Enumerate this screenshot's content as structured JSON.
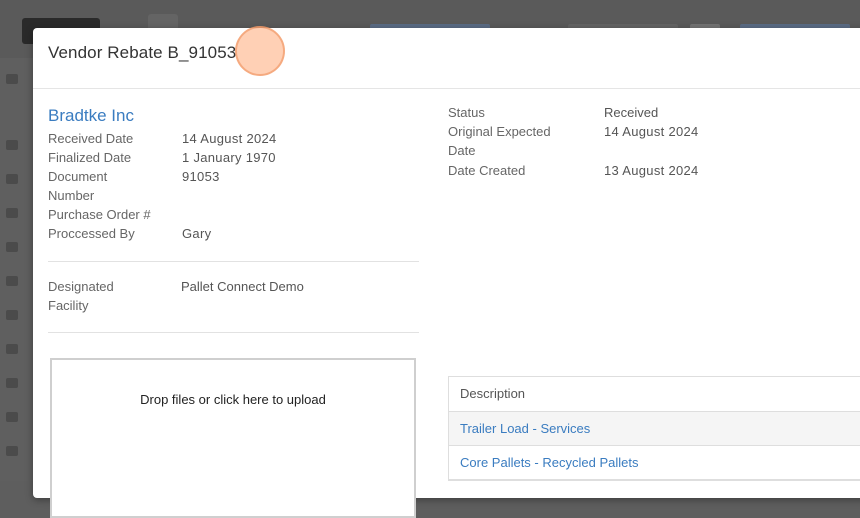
{
  "modal": {
    "title": "Vendor Rebate B_91053"
  },
  "vendor": {
    "name": "Bradtke Inc"
  },
  "details_left": [
    {
      "label": "Received Date",
      "value": "14 August 2024"
    },
    {
      "label": "Finalized Date",
      "value": "1 January 1970"
    },
    {
      "label": "Document Number",
      "value": "91053"
    },
    {
      "label": "Purchase Order #",
      "value": ""
    },
    {
      "label": "Proccessed By",
      "value": "Gary"
    }
  ],
  "facility": {
    "label": "Designated Facility",
    "value": "Pallet Connect Demo"
  },
  "details_right": [
    {
      "label": "Status",
      "value": "Received"
    },
    {
      "label": "Original Expected Date",
      "value": "14 August 2024"
    },
    {
      "label": "Date Created",
      "value": "13 August 2024"
    }
  ],
  "upload": {
    "text": "Drop files or click here to upload"
  },
  "items_table": {
    "header": "Description",
    "rows": [
      "Trailer Load - Services",
      "Core Pallets - Recycled Pallets"
    ]
  }
}
